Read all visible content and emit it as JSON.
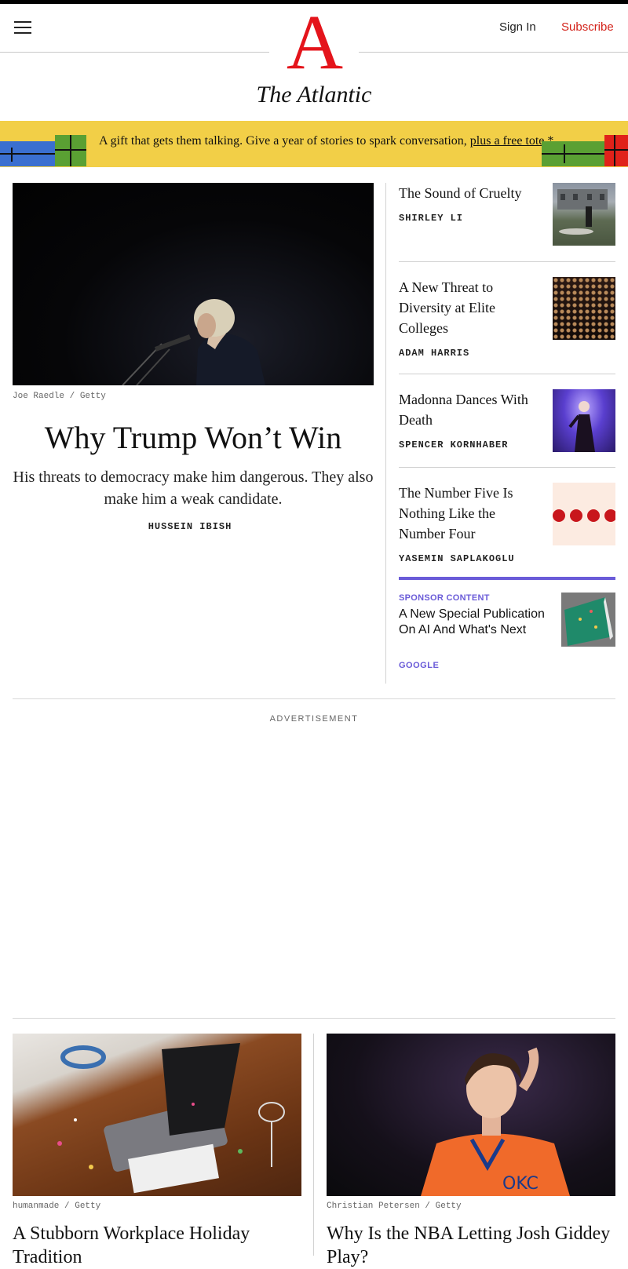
{
  "header": {
    "logo_letter": "A",
    "wordmark": "The Atlantic",
    "sign_in": "Sign In",
    "subscribe": "Subscribe"
  },
  "promo": {
    "text": "A gift that gets them talking. Give a year of stories to spark conversation, ",
    "link": "plus a free tote.",
    "suffix": "*"
  },
  "hero": {
    "credit": "Joe Raedle / Getty",
    "title": "Why Trump Won’t Win",
    "dek": "His threats to democracy make him dangerous. They also make him a weak candidate.",
    "byline": "HUSSEIN IBISH"
  },
  "side_stories": [
    {
      "title": "The Sound of Cruelty",
      "byline": "SHIRLEY LI"
    },
    {
      "title": "A New Threat to Diversity at Elite Colleges",
      "byline": "ADAM HARRIS"
    },
    {
      "title": "Madonna Dances With Death",
      "byline": "SPENCER KORNHABER"
    },
    {
      "title": "The Number Five Is Nothing Like the Number Four",
      "byline": "YASEMIN SAPLAKOGLU"
    }
  ],
  "sponsor": {
    "label": "SPONSOR CONTENT",
    "title": "A New Special Publication On AI And What's Next",
    "by": "GOOGLE"
  },
  "advertisement_label": "ADVERTISEMENT",
  "cards": [
    {
      "credit": "humanmade / Getty",
      "title": "A Stubborn Workplace Holiday Tradition"
    },
    {
      "credit": "Christian Petersen / Getty",
      "title": "Why Is the NBA Letting Josh Giddey Play?"
    }
  ],
  "colors": {
    "brand_red": "#e4141b",
    "subscribe_red": "#d3221a",
    "promo_yellow": "#f2cf47",
    "sponsor_purple": "#6a5bd8"
  },
  "icons": [
    "menu-icon",
    "gift-box-icon"
  ]
}
